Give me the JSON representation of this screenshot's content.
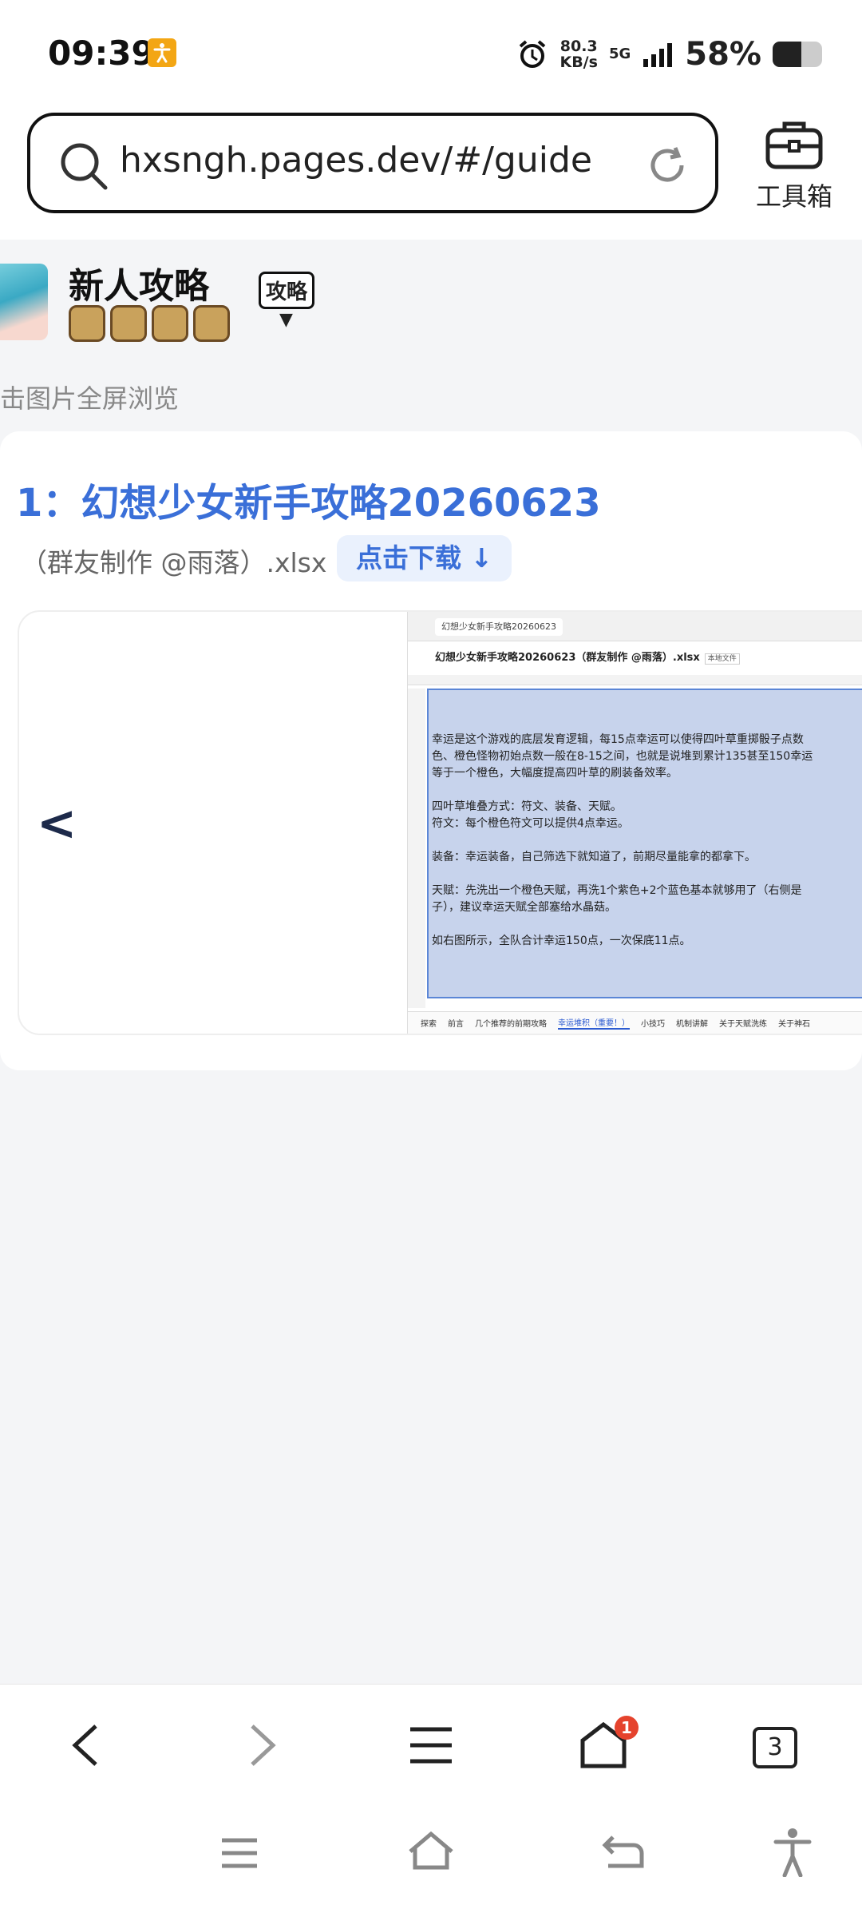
{
  "status_bar": {
    "time": "09:39",
    "net_speed_value": "80.3",
    "net_speed_unit": "KB/s",
    "network": "5G",
    "battery_percent_text": "58%",
    "battery_level": 0.58,
    "accent_color": "#f3a614"
  },
  "browser": {
    "url": "hxsngh.pages.dev/#/guide",
    "toolbox_label": "工具箱"
  },
  "page": {
    "title": "新人攻略",
    "tag": "攻略",
    "hint": "击图片全屏浏览"
  },
  "card": {
    "title": "1：幻想少女新手攻略20260623",
    "subtitle": "（群友制作 @雨落）.xlsx",
    "download_label": "点击下载 ↓",
    "link_color": "#3a6fd8"
  },
  "preview": {
    "tab_title": "幻想少女新手攻略20260623",
    "file_title": "幻想少女新手攻略20260623（群友制作 @雨落）.xlsx",
    "file_badge": "本地文件",
    "text": "幸运是这个游戏的底层发育逻辑，每15点幸运可以使得四叶草重掷骰子点数\n色、橙色怪物初始点数一般在8-15之间，也就是说堆到累计135甚至150幸运\n等于一个橙色，大幅度提高四叶草的刷装备效率。\n\n四叶草堆叠方式：符文、装备、天赋。\n符文：每个橙色符文可以提供4点幸运。\n\n装备：幸运装备，自己筛选下就知道了，前期尽量能拿的都拿下。\n\n天赋：先洗出一个橙色天赋，再洗1个紫色+2个蓝色基本就够用了（右侧是\n子），建议幸运天赋全部塞给水晶菇。\n\n如右图所示，全队合计幸运150点，一次保底11点。",
    "sheet_tabs": [
      "探索",
      "前言",
      "几个推荐的前期攻略",
      "幸运堆积（重要！）",
      "小技巧",
      "机制讲解",
      "关于天赋洗练",
      "关于神石"
    ],
    "active_sheet_index": 3
  },
  "bottom_nav": {
    "notification_count": "1",
    "tab_count": "3"
  }
}
